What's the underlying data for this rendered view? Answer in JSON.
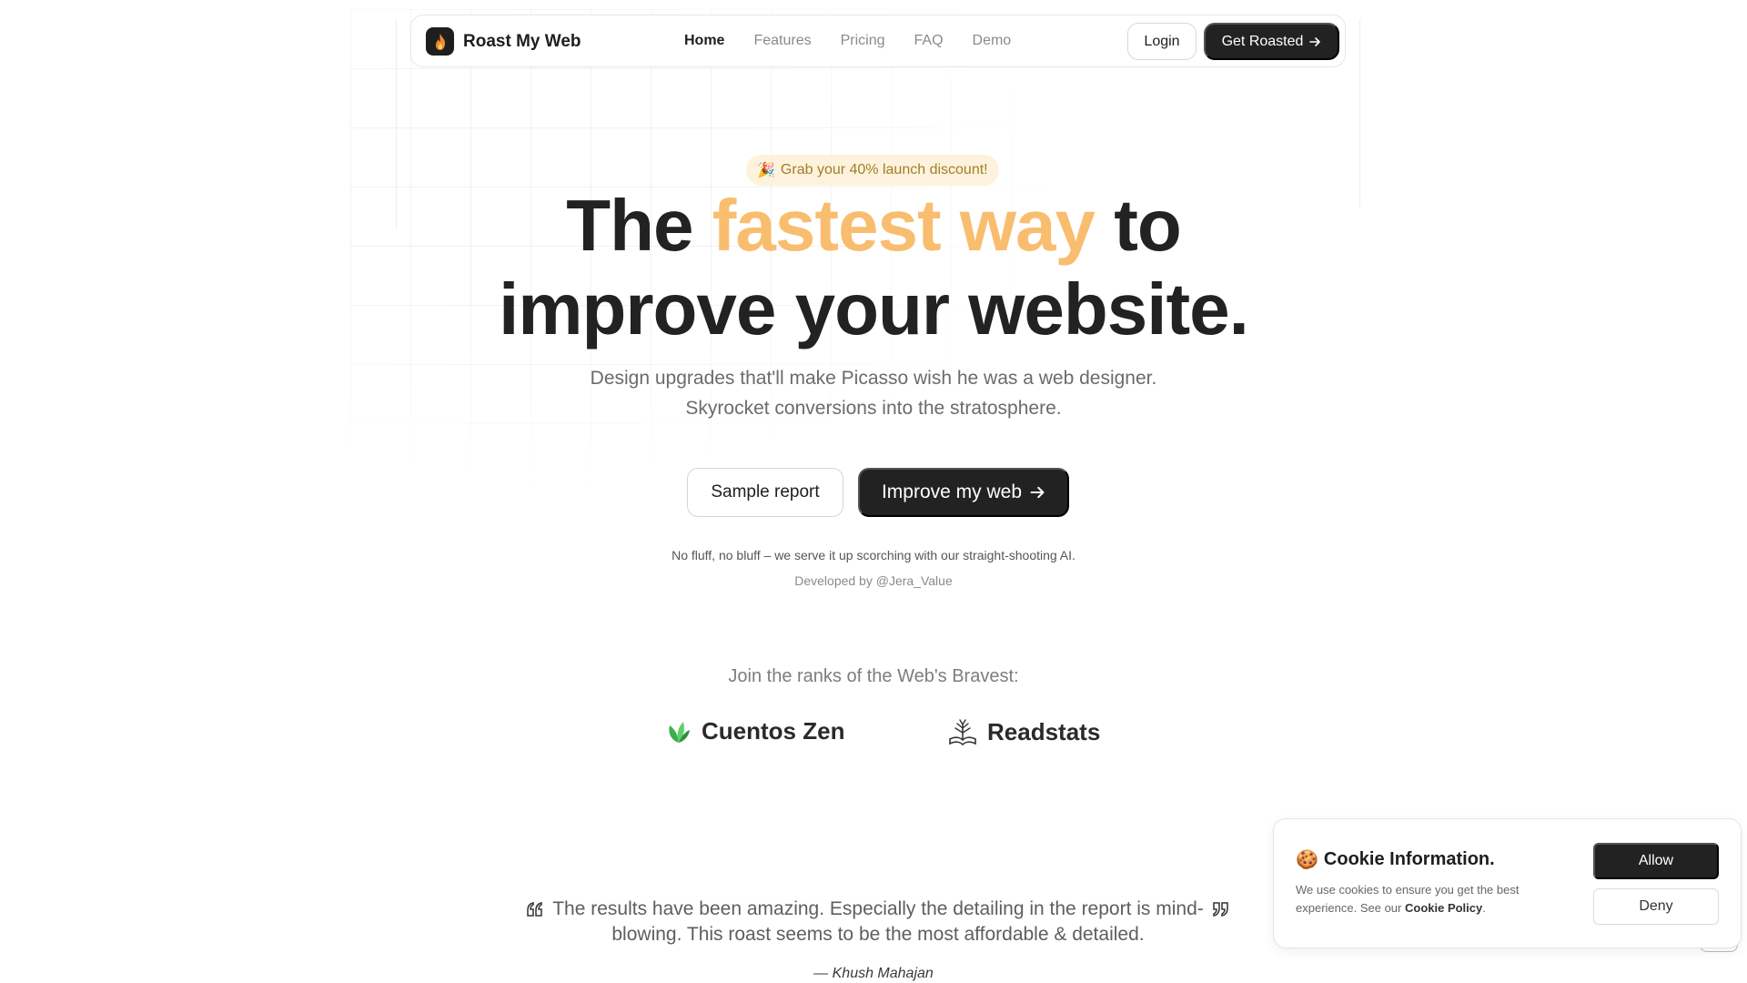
{
  "nav": {
    "brand": "Roast My Web",
    "links": [
      {
        "label": "Home",
        "active": true
      },
      {
        "label": "Features",
        "active": false
      },
      {
        "label": "Pricing",
        "active": false
      },
      {
        "label": "FAQ",
        "active": false
      },
      {
        "label": "Demo",
        "active": false
      }
    ],
    "login_label": "Login",
    "cta_label": "Get Roasted"
  },
  "hero": {
    "badge": "Grab your 40% launch discount!",
    "title_line1_a": "The",
    "title_line1_accent": "fastest way",
    "title_line1_b": "to",
    "title_line2": "improve your website.",
    "subtitle_1": "Design upgrades that'll make Picasso wish he was a web designer.",
    "subtitle_2": "Skyrocket conversions into the stratosphere.",
    "sample_button": "Sample report",
    "improve_button": "Improve my web",
    "note": "No fluff, no bluff – we serve it up scorching with our straight-shooting AI.",
    "developer": "Developed by @Jera_Value"
  },
  "social_proof": {
    "heading": "Join the ranks of the Web's Bravest:",
    "logos": [
      {
        "name": "Cuentos Zen",
        "icon": "leaf-icon"
      },
      {
        "name": "Readstats",
        "icon": "book-tree-icon"
      }
    ]
  },
  "testimonial": {
    "quote": "The results have been amazing. Especially the detailing in the report is mind-blowing. This roast seems to be the most affordable & detailed.",
    "author": "— Khush Mahajan"
  },
  "cookie": {
    "title": "Cookie Information.",
    "text": "We use cookies to ensure you get the best experience. See our",
    "policy_link": "Cookie Policy",
    "allow": "Allow",
    "deny": "Deny"
  },
  "colors": {
    "accent": "#f9bd6f",
    "dark": "#222222",
    "badge_bg": "#fdf3dc"
  }
}
